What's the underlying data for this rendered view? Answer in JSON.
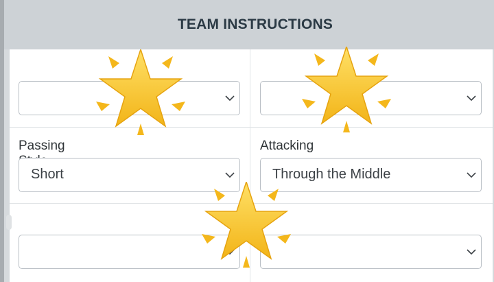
{
  "header": {
    "title": "TEAM INSTRUCTIONS"
  },
  "fields": [
    {
      "label": "",
      "value": ""
    },
    {
      "label": "",
      "value": ""
    },
    {
      "label": "Passing Style",
      "value": "Short"
    },
    {
      "label": "Attacking",
      "value": "Through the Middle"
    },
    {
      "label": "",
      "value": ""
    },
    {
      "label": "",
      "value": ""
    }
  ],
  "icons": {
    "chevron": "chevron-down-icon",
    "overlay": "sparkle-star-emoji"
  },
  "colors": {
    "header_bg": "#cdd2d6",
    "header_text": "#2b3a45",
    "star": "#f7c21c",
    "border": "#b9bfc5"
  }
}
